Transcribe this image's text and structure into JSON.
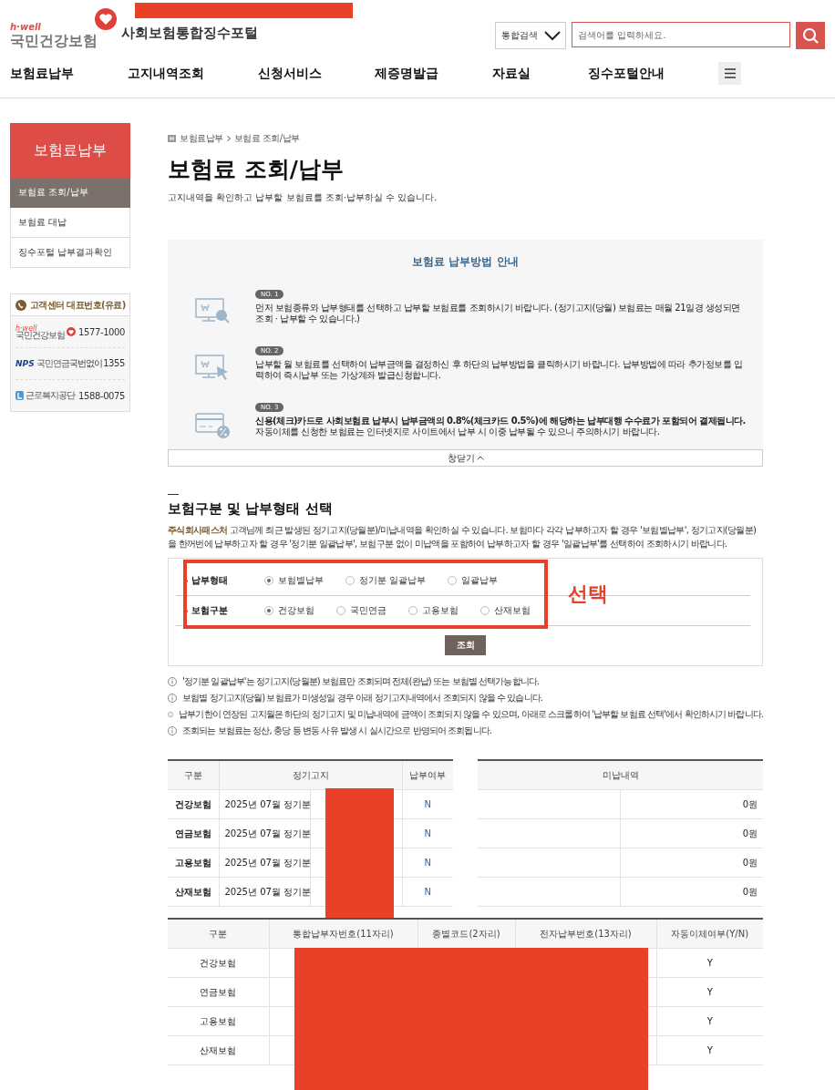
{
  "logo": {
    "tagline": "h·well",
    "name": "국민건강보험",
    "portal": "사회보험통합징수포털"
  },
  "search": {
    "scope": "통합검색",
    "placeholder": "검색어를 입력하세요."
  },
  "nav": [
    "보험료납부",
    "고지내역조회",
    "신청서비스",
    "제증명발급",
    "자료실",
    "징수포털안내"
  ],
  "sidebar": {
    "title": "보험료납부",
    "items": [
      {
        "label": "보험료 조회/납부",
        "selected": true
      },
      {
        "label": "보험료 대납",
        "selected": false
      },
      {
        "label": "징수포털 납부결과확인",
        "selected": false
      }
    ]
  },
  "call_center": {
    "title": "고객센터 대표번호(유료)",
    "entries": [
      {
        "kind": "nhis",
        "tagline": "h·well",
        "org": "국민건강보험",
        "number": "1577-1000"
      },
      {
        "kind": "nps",
        "tagline": "NPS",
        "org": "국민연금",
        "prefix": "국번없이",
        "number": "1355"
      },
      {
        "kind": "comwel",
        "org": "근로복지공단",
        "number": "1588-0075"
      }
    ]
  },
  "breadcrumb": [
    "보험료납부",
    "보험료 조회/납부"
  ],
  "page_title": "보험료 조회/납부",
  "page_description": "고지내역을 확인하고 납부할 보험료를 조회·납부하실 수 있습니다.",
  "guide": {
    "title": "보험료 납부방법 안내",
    "steps": [
      {
        "kind": "search",
        "badge": "NO. 1",
        "text": "먼저 보험종류와 납부형태를 선택하고 납부할 보험료를 조회하시기 바랍니다. (정기고지(당월) 보험료는 매월 21일경 생성되면 조회 · 납부할 수 있습니다.)"
      },
      {
        "kind": "click",
        "badge": "NO. 2",
        "text": "납부할 월 보험료를 선택하여 납부금액을 결정하신 후 하단의 납부방법을 클릭하시기 바랍니다. 납부방법에 따라 추가정보를 입력하여 즉시납부 또는 가상계좌 발급신청합니다."
      },
      {
        "kind": "card",
        "badge": "NO. 3",
        "text": "**신용(체크)카드로 사회보험료 납부시 납부금액의 0.8%(체크카드 0.5%)에 해당하는 납부대행 수수료가 포함되어 결제됩니다.** 자동이체를 신청한 보험료는 인터넷지로 사이트에서 납부 시 이중 납부될 수 있으니 주의하시기 바랍니다."
      }
    ],
    "close": "창닫기"
  },
  "selection": {
    "title": "보험구분 및 납부형태 선택",
    "intro": "**주식회사패스처** 고객님께 최근 발생된 정기고지(당월분)/미납내역을 확인하실 수 있습니다. 보험마다 각각 납부하고자 할 경우 '보험별납부', 정기고지(당월분)을 한꺼번에 납부하고자 할 경우 '정기분 일괄납부', 보험구분 없이 미납액을 포함하여 납부하고자 할 경우 '일괄납부'를 선택하여 조회하시기 바랍니다.",
    "groups": [
      {
        "label": "납부형태",
        "options": [
          {
            "label": "보험별납부",
            "selected": true
          },
          {
            "label": "정기분 일괄납부",
            "selected": false
          },
          {
            "label": "일괄납부",
            "selected": false
          }
        ]
      },
      {
        "label": "보험구분",
        "options": [
          {
            "label": "건강보험",
            "selected": true
          },
          {
            "label": "국민연금",
            "selected": false
          },
          {
            "label": "고용보험",
            "selected": false
          },
          {
            "label": "산재보험",
            "selected": false
          }
        ]
      }
    ],
    "annotation": "선택",
    "submit": "조회",
    "notes": [
      "'정기분 일괄납부'는 정기고지(당월분) 보험료만 조회되며 전체(완납) 또는 보험별 선택가능합니다.",
      "보험별 정기고지(당월) 보험료가 미생성일 경우 아래 정기고지내역에서 조회되지 않을 수 있습니다.",
      "납부기한이 연장된 고지월은 하단의 정기고지 및 미납내역에 금액이 조회되지 않을 수 있으며, 아래로 스크롤하여 '납부할 보험료 선택'에서 확인하시기 바랍니다.",
      "조회되는 보험료는 정산, 충당 등 변동 사유 발생 시 실시간으로 반영되어 조회됩니다."
    ]
  },
  "status_table": {
    "columns": [
      "구분",
      "정기고지",
      "납부여부"
    ],
    "rows": [
      {
        "category": "건강보험",
        "period": "2025년 07월 정기분",
        "paid": "N"
      },
      {
        "category": "연금보험",
        "period": "2025년 07월 정기분",
        "paid": "N"
      },
      {
        "category": "고용보험",
        "period": "2025년 07월 정기분",
        "paid": "N"
      },
      {
        "category": "산재보험",
        "period": "2025년 07월 정기분",
        "paid": "N"
      }
    ]
  },
  "unpaid_table": {
    "title": "미납내역",
    "rows": [
      {
        "amount": "0원"
      },
      {
        "amount": "0원"
      },
      {
        "amount": "0원"
      },
      {
        "amount": "0원"
      }
    ]
  },
  "account_table": {
    "columns": [
      "구분",
      "통합납부자번호(11자리)",
      "종별코드(2자리)",
      "전자납부번호(13자리)",
      "자동이체여부(Y/N)"
    ],
    "rows": [
      {
        "category": "건강보험",
        "auto_transfer": "Y"
      },
      {
        "category": "연금보험",
        "auto_transfer": "Y"
      },
      {
        "category": "고용보험",
        "auto_transfer": "Y"
      },
      {
        "category": "산재보험",
        "auto_transfer": "Y"
      }
    ]
  }
}
